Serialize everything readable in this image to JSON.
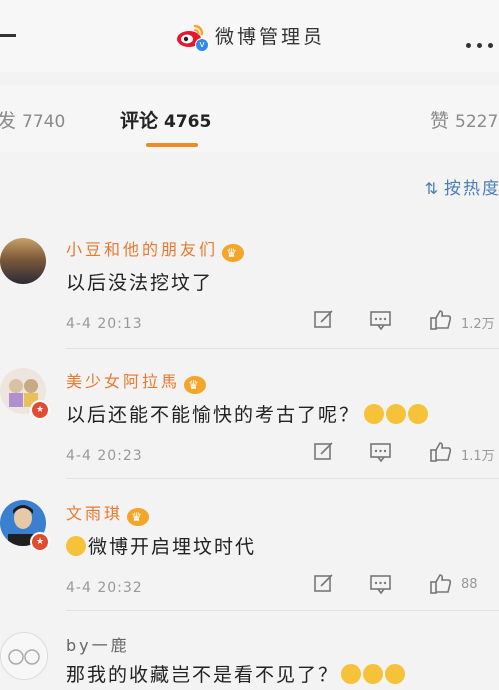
{
  "header": {
    "title": "微博管理员",
    "verified_mark": "v"
  },
  "tabs": [
    {
      "label": "转发",
      "count": "7740"
    },
    {
      "label": "评论",
      "count": "4765"
    },
    {
      "label": "赞",
      "count": "5227"
    }
  ],
  "sort": {
    "label": "按热度"
  },
  "comments": [
    {
      "user": "小豆和他的朋友们",
      "text": "以后没法挖坟了",
      "time": "4-4 20:13",
      "likes": "1.2万",
      "emoji_count": 0
    },
    {
      "user": "美少女阿拉馬",
      "text": "以后还能不能愉快的考古了呢？",
      "time": "4-4 20:23",
      "likes": "1.1万",
      "emoji_count": 3
    },
    {
      "user": "文雨琪",
      "text": "微博开启埋坟时代",
      "time": "4-4 20:32",
      "likes": "88",
      "emoji_count": 1
    },
    {
      "user": "by一鹿",
      "text": "那我的收藏岂不是看不见了？",
      "emoji_count": 3
    }
  ],
  "colors": {
    "accent_orange": "#f08a24",
    "username_orange": "#e8792f",
    "link_blue": "#4a7fb5"
  }
}
